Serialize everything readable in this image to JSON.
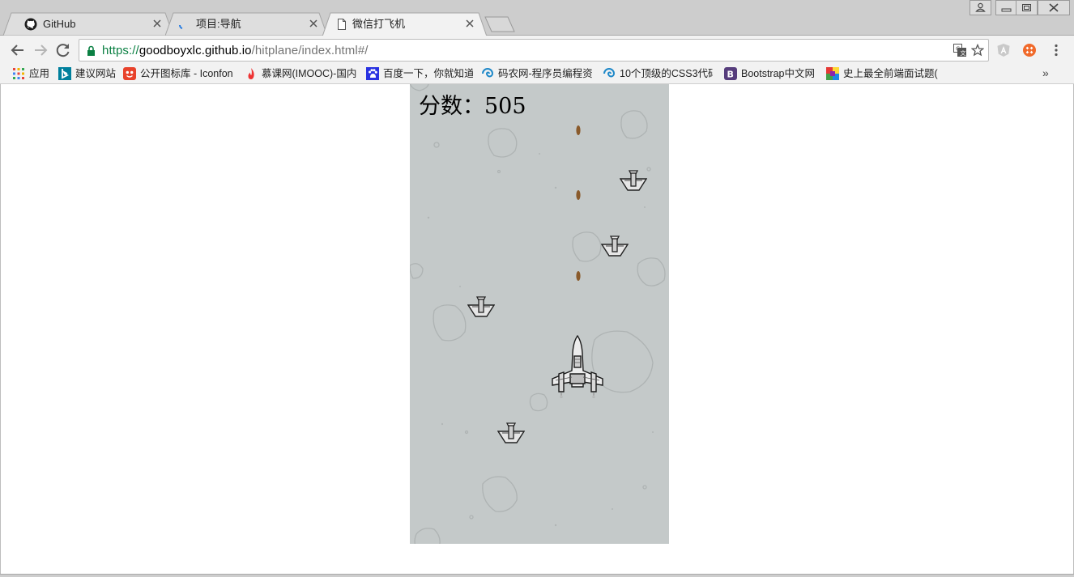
{
  "browser": {
    "tabs": [
      {
        "title": "GitHub",
        "icon": "github-icon",
        "active": false
      },
      {
        "title": "项目:导航",
        "icon": "loading-icon",
        "active": false
      },
      {
        "title": "微信打飞机",
        "icon": "page-icon",
        "active": true
      }
    ],
    "url": {
      "scheme": "https://",
      "host": "goodboyxlc.github.io",
      "path": "/hitplane/index.html#/"
    },
    "bookmarks": [
      {
        "label": "应用",
        "icon": "apps-grid-icon"
      },
      {
        "label": "建议网站",
        "icon": "bing-icon"
      },
      {
        "label": "公开图标库 - Iconfon",
        "icon": "iconfont-icon"
      },
      {
        "label": "慕课网(IMOOC)-国内",
        "icon": "imooc-flame-icon"
      },
      {
        "label": "百度一下，你就知道",
        "icon": "baidu-paw-icon"
      },
      {
        "label": "码农网-程序员编程资",
        "icon": "swirl-icon"
      },
      {
        "label": "10个顶级的CSS3代码",
        "icon": "swirl-icon"
      },
      {
        "label": "Bootstrap中文网",
        "icon": "bootstrap-icon"
      },
      {
        "label": "史上最全前端面试题(",
        "icon": "colorful-blocks-icon"
      }
    ],
    "bookmarks_more": "»"
  },
  "game": {
    "score_label": "分数：",
    "score_value": "505",
    "background_color": "#c4c9c9",
    "bullet_color": "#8a5a2b"
  }
}
